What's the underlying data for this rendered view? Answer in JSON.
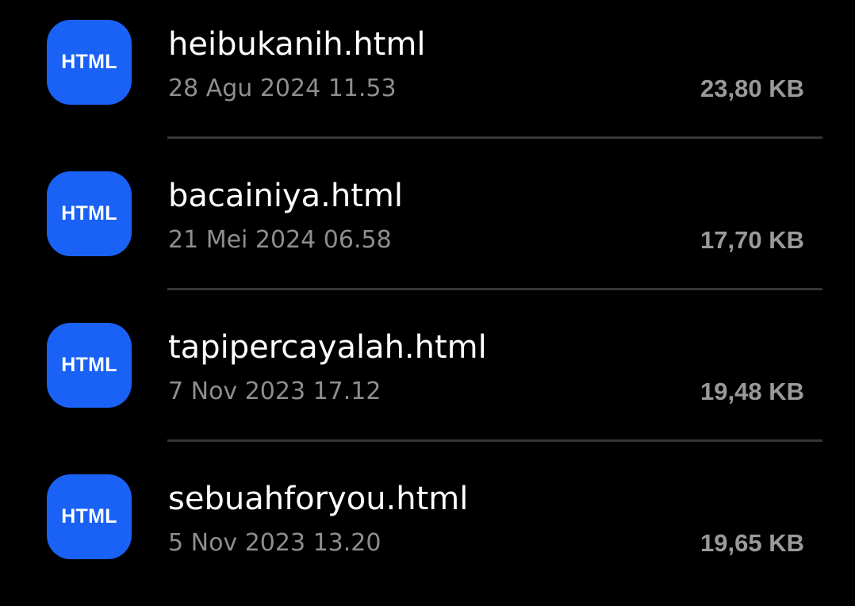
{
  "files": [
    {
      "icon": "html-file-icon",
      "icon_label": "HTML",
      "name": "heibukanih.html",
      "date": "28 Agu 2024 11.53",
      "size": "23,80 KB"
    },
    {
      "icon": "html-file-icon",
      "icon_label": "HTML",
      "name": "bacainiya.html",
      "date": "21 Mei 2024 06.58",
      "size": "17,70 KB"
    },
    {
      "icon": "html-file-icon",
      "icon_label": "HTML",
      "name": "tapipercayalah.html",
      "date": "7 Nov 2023 17.12",
      "size": "19,48 KB"
    },
    {
      "icon": "html-file-icon",
      "icon_label": "HTML",
      "name": "sebuahforyou.html",
      "date": "5 Nov 2023 13.20",
      "size": "19,65 KB"
    }
  ],
  "colors": {
    "background": "#000000",
    "icon_blue": "#1a62f5",
    "name_text": "#ffffff",
    "meta_text": "#8e8e8e",
    "divider": "#363636"
  }
}
